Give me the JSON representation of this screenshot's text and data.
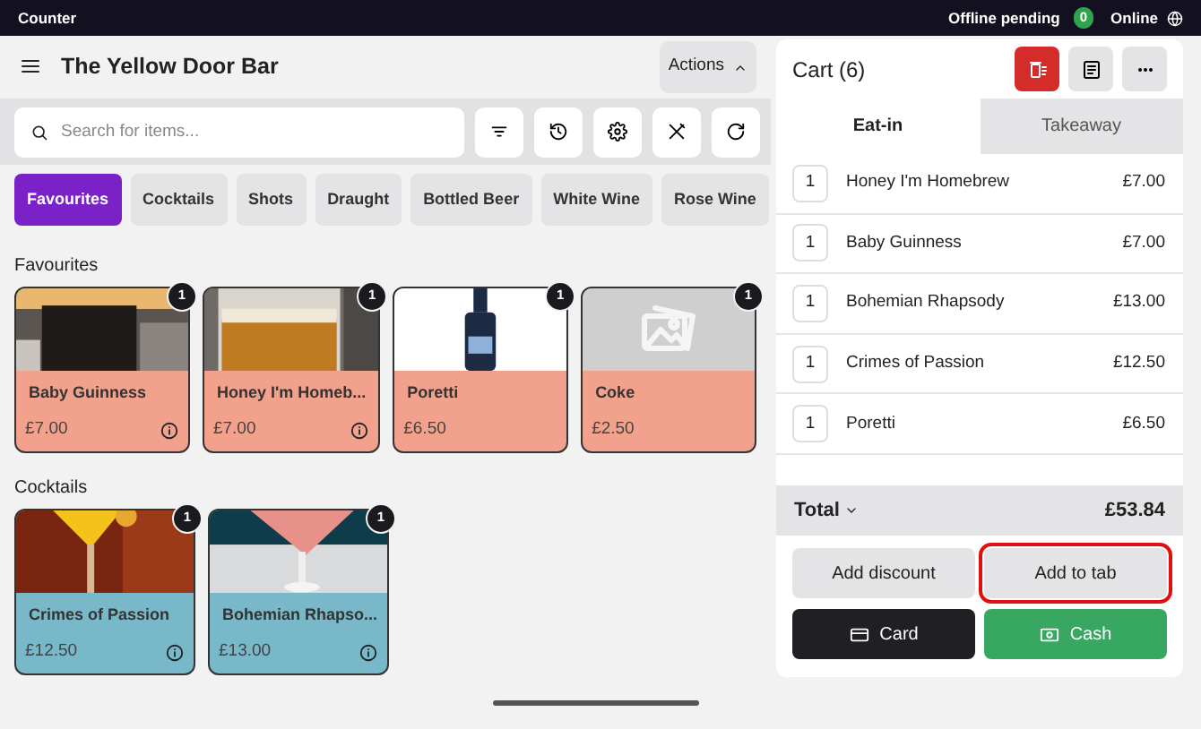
{
  "status_bar": {
    "device": "Counter",
    "offline_label": "Offline pending",
    "offline_count": "0",
    "online_label": "Online"
  },
  "header": {
    "title": "The Yellow Door Bar",
    "actions": "Actions"
  },
  "search": {
    "placeholder": "Search for items..."
  },
  "categories": [
    {
      "label": "Favourites",
      "selected": true
    },
    {
      "label": "Cocktails",
      "selected": false
    },
    {
      "label": "Shots",
      "selected": false
    },
    {
      "label": "Draught",
      "selected": false
    },
    {
      "label": "Bottled Beer",
      "selected": false
    },
    {
      "label": "White Wine",
      "selected": false
    },
    {
      "label": "Rose Wine",
      "selected": false
    }
  ],
  "sections": [
    {
      "title": "Favourites",
      "items": [
        {
          "name": "Baby Guinness",
          "price": "£7.00",
          "count": "1",
          "color": "#f2a28c",
          "kind": "picture",
          "info": true
        },
        {
          "name": "Honey I'm Homeb...",
          "price": "£7.00",
          "count": "1",
          "color": "#f2a28c",
          "kind": "picture",
          "info": true
        },
        {
          "name": "Poretti",
          "price": "£6.50",
          "count": "1",
          "color": "#f2a28c",
          "kind": "picture",
          "info": false
        },
        {
          "name": "Coke",
          "price": "£2.50",
          "count": "1",
          "color": "#f2a28c",
          "kind": "placeholder",
          "info": false
        }
      ]
    },
    {
      "title": "Cocktails",
      "items": [
        {
          "name": "Crimes of Passion",
          "price": "£12.50",
          "count": "1",
          "color": "#79b8c8",
          "kind": "picture",
          "info": true
        },
        {
          "name": "Bohemian Rhapso...",
          "price": "£13.00",
          "count": "1",
          "color": "#79b8c8",
          "kind": "picture",
          "info": true
        }
      ]
    }
  ],
  "cart": {
    "title": "Cart (6)",
    "tabs": [
      {
        "label": "Eat-in",
        "selected": true
      },
      {
        "label": "Takeaway",
        "selected": false
      }
    ],
    "lines": [
      {
        "qty": "1",
        "name": "Honey I'm Homebrew",
        "price": "£7.00"
      },
      {
        "qty": "1",
        "name": "Baby Guinness",
        "price": "£7.00"
      },
      {
        "qty": "1",
        "name": "Bohemian Rhapsody",
        "price": "£13.00"
      },
      {
        "qty": "1",
        "name": "Crimes of Passion",
        "price": "£12.50"
      },
      {
        "qty": "1",
        "name": "Poretti",
        "price": "£6.50"
      }
    ],
    "total_label": "Total",
    "total": "£53.84",
    "actions": [
      {
        "label": "Add discount",
        "kind": "plain",
        "highlighted": false
      },
      {
        "label": "Add to tab",
        "kind": "plain",
        "highlighted": true
      },
      {
        "label": "Card",
        "kind": "card",
        "highlighted": false
      },
      {
        "label": "Cash",
        "kind": "cash",
        "highlighted": false
      }
    ]
  }
}
